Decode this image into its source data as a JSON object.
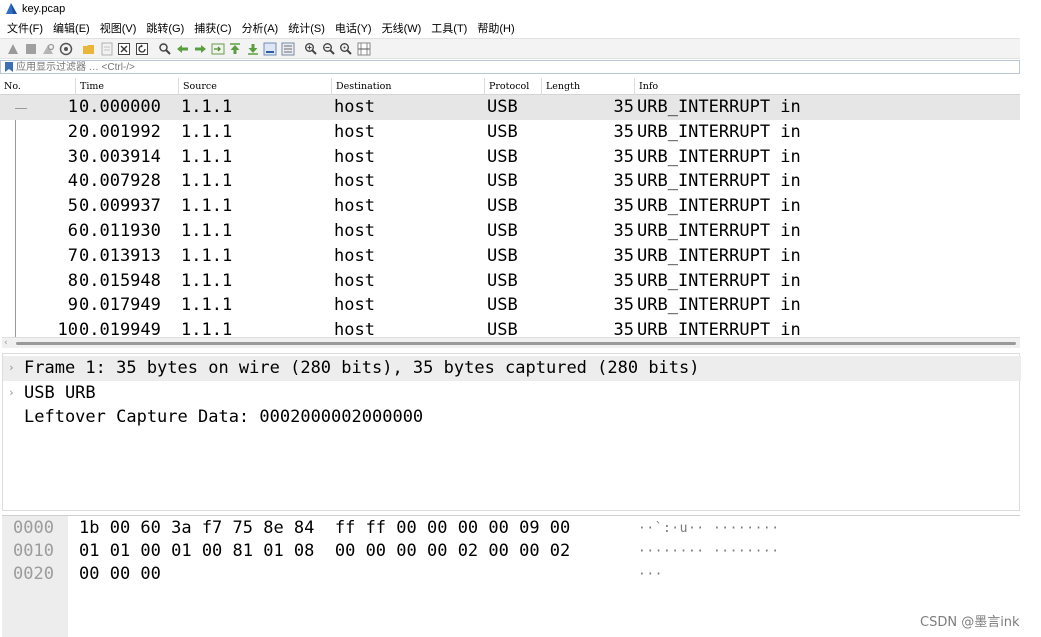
{
  "window": {
    "title": "key.pcap"
  },
  "menu": [
    "文件(F)",
    "编辑(E)",
    "视图(V)",
    "跳转(G)",
    "捕获(C)",
    "分析(A)",
    "统计(S)",
    "电话(Y)",
    "无线(W)",
    "工具(T)",
    "帮助(H)"
  ],
  "toolbar_icons": [
    "start-capture-icon",
    "stop-capture-icon",
    "restart-capture-icon",
    "capture-options-icon",
    "open-file-icon",
    "save-file-icon",
    "close-file-icon",
    "reload-icon",
    "find-packet-icon",
    "go-back-icon",
    "go-forward-icon",
    "go-to-packet-icon",
    "go-first-icon",
    "go-last-icon",
    "auto-scroll-icon",
    "colorize-icon",
    "zoom-in-icon",
    "zoom-out-icon",
    "zoom-normal-icon",
    "resize-columns-icon"
  ],
  "filter": {
    "placeholder": "应用显示过滤器 … <Ctrl-/>"
  },
  "columns": [
    "No.",
    "Time",
    "Source",
    "Destination",
    "Protocol",
    "Length",
    "Info"
  ],
  "packets": [
    {
      "no": "1",
      "time": "0.000000",
      "source": "1.1.1",
      "destination": "host",
      "protocol": "USB",
      "length": "35",
      "info": "URB_INTERRUPT in"
    },
    {
      "no": "2",
      "time": "0.001992",
      "source": "1.1.1",
      "destination": "host",
      "protocol": "USB",
      "length": "35",
      "info": "URB_INTERRUPT in"
    },
    {
      "no": "3",
      "time": "0.003914",
      "source": "1.1.1",
      "destination": "host",
      "protocol": "USB",
      "length": "35",
      "info": "URB_INTERRUPT in"
    },
    {
      "no": "4",
      "time": "0.007928",
      "source": "1.1.1",
      "destination": "host",
      "protocol": "USB",
      "length": "35",
      "info": "URB_INTERRUPT in"
    },
    {
      "no": "5",
      "time": "0.009937",
      "source": "1.1.1",
      "destination": "host",
      "protocol": "USB",
      "length": "35",
      "info": "URB_INTERRUPT in"
    },
    {
      "no": "6",
      "time": "0.011930",
      "source": "1.1.1",
      "destination": "host",
      "protocol": "USB",
      "length": "35",
      "info": "URB_INTERRUPT in"
    },
    {
      "no": "7",
      "time": "0.013913",
      "source": "1.1.1",
      "destination": "host",
      "protocol": "USB",
      "length": "35",
      "info": "URB_INTERRUPT in"
    },
    {
      "no": "8",
      "time": "0.015948",
      "source": "1.1.1",
      "destination": "host",
      "protocol": "USB",
      "length": "35",
      "info": "URB_INTERRUPT in"
    },
    {
      "no": "9",
      "time": "0.017949",
      "source": "1.1.1",
      "destination": "host",
      "protocol": "USB",
      "length": "35",
      "info": "URB_INTERRUPT in"
    },
    {
      "no": "10",
      "time": "0.019949",
      "source": "1.1.1",
      "destination": "host",
      "protocol": "USB",
      "length": "35",
      "info": "URB_INTERRUPT in"
    }
  ],
  "details": [
    {
      "text": "Frame 1: 35 bytes on wire (280 bits), 35 bytes captured (280 bits)",
      "expandable": true
    },
    {
      "text": "USB URB",
      "expandable": true
    },
    {
      "text": "Leftover Capture Data: 0002000002000000",
      "expandable": false
    }
  ],
  "bytes": [
    {
      "offset": "0000",
      "hex": "1b 00 60 3a f7 75 8e 84  ff ff 00 00 00 00 09 00",
      "ascii": "··`:·u·· ········"
    },
    {
      "offset": "0010",
      "hex": "01 01 00 01 00 81 01 08  00 00 00 00 02 00 00 02",
      "ascii": "········ ········"
    },
    {
      "offset": "0020",
      "hex": "00 00 00",
      "ascii": "···"
    }
  ],
  "watermark": "CSDN @墨言ink"
}
